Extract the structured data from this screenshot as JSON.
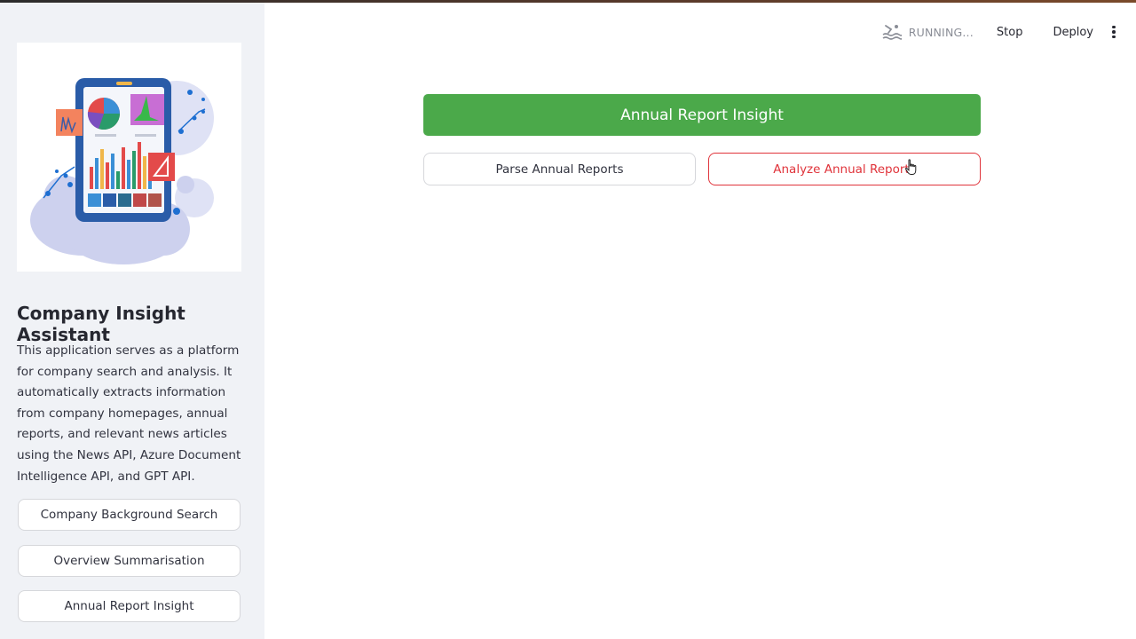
{
  "header": {
    "status_text": "RUNNING...",
    "status_icon": "swimmer-icon",
    "stop_label": "Stop",
    "deploy_label": "Deploy",
    "menu_icon": "kebab-menu-icon"
  },
  "sidebar": {
    "logo_icon": "analytics-tablet-illustration",
    "title": "Company Insight Assistant",
    "description": "This application serves as a platform for company search and analysis. It automatically extracts information from company homepages, annual reports, and relevant news articles using the News API, Azure Document Intelligence API, and GPT API.",
    "nav_buttons": [
      {
        "label": "Company Background Search"
      },
      {
        "label": "Overview Summarisation"
      },
      {
        "label": "Annual Report Insight"
      }
    ]
  },
  "main": {
    "title_button": "Annual Report Insight",
    "parse_button": "Parse Annual Reports",
    "analyze_button": "Analyze Annual Reports"
  },
  "colors": {
    "primary_green": "#4ba94a",
    "danger_red": "#e0343b",
    "sidebar_bg": "#f0f2f6"
  }
}
